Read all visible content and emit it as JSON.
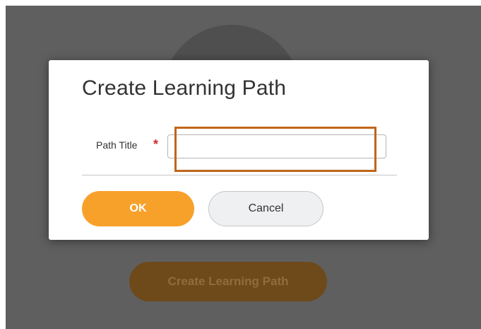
{
  "background": {
    "create_button_label": "Create Learning Path"
  },
  "dialog": {
    "title": "Create Learning Path",
    "field": {
      "label": "Path Title",
      "required_marker": "*",
      "value": ""
    },
    "buttons": {
      "ok_label": "OK",
      "cancel_label": "Cancel"
    }
  },
  "colors": {
    "overlay": "#5f5f5f",
    "primary_button": "#f7a12b",
    "required_marker": "#d12c2c",
    "focus_highlight": "#c0651a"
  }
}
